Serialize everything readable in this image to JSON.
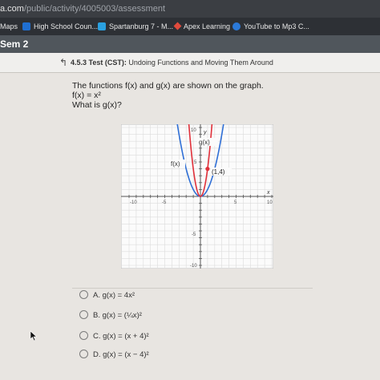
{
  "browser": {
    "url_host": "a.com",
    "url_path": "/public/activity/4005003/assessment",
    "bookmarks": [
      {
        "label": "Maps",
        "color": "#3c7bd6"
      },
      {
        "label": "High School Coun...",
        "color": "#1f6fd2"
      },
      {
        "label": "Spartanburg 7 - M...",
        "color": "#2aa0e0"
      },
      {
        "label": "Apex Learning",
        "color": "#e04a3c"
      },
      {
        "label": "YouTube to Mp3 C...",
        "color": "#2b79d8"
      }
    ]
  },
  "course": {
    "title": "Sem 2"
  },
  "assessment": {
    "back_icon": "↰",
    "code": "4.5.3",
    "type": "Test (CST):",
    "name": "Undoing Functions and Moving Them Around"
  },
  "question": {
    "line1": "The functions f(x) and g(x) are shown on the graph.",
    "line2": "f(x) = x²",
    "line3": "What is g(x)?"
  },
  "graph": {
    "label_g": "g(x)",
    "label_f": "f(x)",
    "point_label": "(1,4)",
    "axis_y": "y",
    "axis_x": "x",
    "tick_10": "10",
    "tick_5": "5",
    "tick_neg5": "-5",
    "tick_neg10": "-10",
    "x_range": [
      -10,
      10
    ],
    "y_range": [
      -10,
      10
    ],
    "f_color": "#2f6fd6",
    "g_color": "#e0303a"
  },
  "choices": [
    {
      "letter": "A.",
      "text": "g(x) = 4x²"
    },
    {
      "letter": "B.",
      "text": "g(x) = (¼x)²"
    },
    {
      "letter": "C.",
      "text": "g(x) = (x + 4)²"
    },
    {
      "letter": "D.",
      "text": "g(x) = (x − 4)²"
    }
  ]
}
